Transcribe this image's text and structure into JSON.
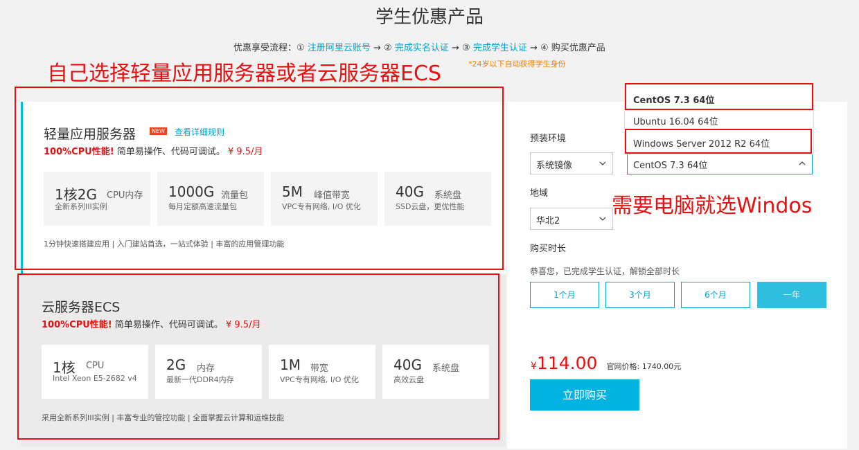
{
  "page": {
    "title": "学生优惠产品"
  },
  "flow": {
    "prefix": "优惠享受流程：",
    "s1_num": "①",
    "s1_link": "注册阿里云账号",
    "arrow": "→",
    "s2_num": "②",
    "s2_link": "完成实名认证",
    "s3_num": "③",
    "s3_link": "完成学生认证",
    "s4": "④ 购买优惠产品",
    "note": "*24岁以下自动获得学生身份"
  },
  "annotations": {
    "choose": "自己选择轻量应用服务器或者云服务器ECS",
    "windows": "需要电脑就选Windos",
    "color": "#e81010"
  },
  "light": {
    "title": "轻量应用服务器",
    "badge": "NEW",
    "rules_link": "查看详细规则",
    "perf_red": "100%CPU性能!",
    "perf_text": " 简单易操作、代码可调试。",
    "price": "¥ 9.5/月",
    "specs": [
      {
        "big": "1核2G",
        "unit": "CPU内存",
        "sub": "全新系列III实例"
      },
      {
        "big": "1000G",
        "unit": "流量包",
        "sub": "每月定额高速流量包"
      },
      {
        "big": "5M",
        "unit": "峰值带宽",
        "sub": "VPC专有网络, I/O 优化"
      },
      {
        "big": "40G",
        "unit": "系统盘",
        "sub": "SSD云盘，更优性能"
      }
    ],
    "features": "1分钟快速搭建应用    |    入门建站首选，一站式体验    |    丰富的应用管理功能"
  },
  "ecs": {
    "title": "云服务器ECS",
    "perf_red": "100%CPU性能!",
    "perf_text": " 简单易操作、代码可调试。",
    "price": "¥ 9.5/月",
    "specs": [
      {
        "big": "1核",
        "unit": "CPU",
        "sub": "Intel Xeon E5-2682 v4"
      },
      {
        "big": "2G",
        "unit": "内存",
        "sub": "最新一代DDR4内存"
      },
      {
        "big": "1M",
        "unit": "带宽",
        "sub": "VPC专有网络, I/O 优化"
      },
      {
        "big": "40G",
        "unit": "系统盘",
        "sub": "高效云盘"
      }
    ],
    "features": "采用全新系列III实例    |    丰富专业的管控功能    |    全面掌握云计算和运维技能"
  },
  "config": {
    "env_label": "预装环境",
    "image_type": "系统镜像",
    "os_selected": "CentOS 7.3 64位",
    "os_options": [
      "CentOS 7.3 64位",
      "Ubuntu 16.04 64位",
      "Windows Server 2012 R2 64位"
    ],
    "region_label": "地域",
    "region_value": "华北2",
    "duration_label": "购买时长",
    "duration_note": "恭喜您，已完成学生认证，解锁全部时长",
    "durations": [
      "1个月",
      "3个月",
      "6个月",
      "一年"
    ],
    "active_duration": "一年",
    "price_symbol": "¥",
    "price": "114.00",
    "original_price": "官网价格: 1740.00元",
    "buy_button": "立即购买"
  },
  "colors": {
    "accent": "#00a2ca",
    "buy": "#00b3e0",
    "price": "#e81010",
    "active_tab": "#2fbfe0"
  }
}
